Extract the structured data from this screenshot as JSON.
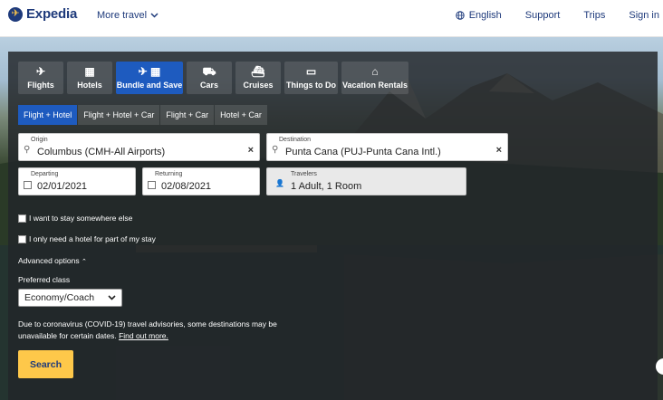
{
  "header": {
    "logo_text": "Expedia",
    "more_travel": "More travel",
    "language": "English",
    "support": "Support",
    "trips": "Trips",
    "sign_in": "Sign in"
  },
  "tabs": [
    {
      "label": "Flights",
      "icon": "plane-icon"
    },
    {
      "label": "Hotels",
      "icon": "building-icon"
    },
    {
      "label": "Bundle and Save",
      "icon": "plane-building-icon",
      "active": true
    },
    {
      "label": "Cars",
      "icon": "car-icon"
    },
    {
      "label": "Cruises",
      "icon": "ship-icon"
    },
    {
      "label": "Things to Do",
      "icon": "ticket-icon"
    },
    {
      "label": "Vacation Rentals",
      "icon": "house-icon"
    }
  ],
  "subtabs": [
    {
      "label": "Flight + Hotel",
      "active": true
    },
    {
      "label": "Flight + Hotel + Car"
    },
    {
      "label": "Flight + Car"
    },
    {
      "label": "Hotel + Car"
    }
  ],
  "origin": {
    "label": "Origin",
    "value": "Columbus (CMH-All Airports)"
  },
  "destination": {
    "label": "Destination",
    "value": "Punta Cana (PUJ-Punta Cana Intl.)"
  },
  "departing": {
    "label": "Departing",
    "value": "02/01/2021"
  },
  "returning": {
    "label": "Returning",
    "value": "02/08/2021"
  },
  "travelers": {
    "label": "Travelers",
    "value": "1 Adult, 1 Room"
  },
  "options": {
    "stay_elsewhere": "I want to stay somewhere else",
    "partial_hotel": "I only need a hotel for part of my stay",
    "advanced": "Advanced options"
  },
  "preferred_class": {
    "label": "Preferred class",
    "value": "Economy/Coach"
  },
  "notice": {
    "text": "Due to coronavirus (COVID-19) travel advisories, some destinations may be unavailable for certain dates.",
    "link": "Find out more."
  },
  "search_button": "Search",
  "colors": {
    "brand_navy": "#1e3a7b",
    "accent_yellow": "#fec84a",
    "active_blue": "#1e5bbf"
  }
}
